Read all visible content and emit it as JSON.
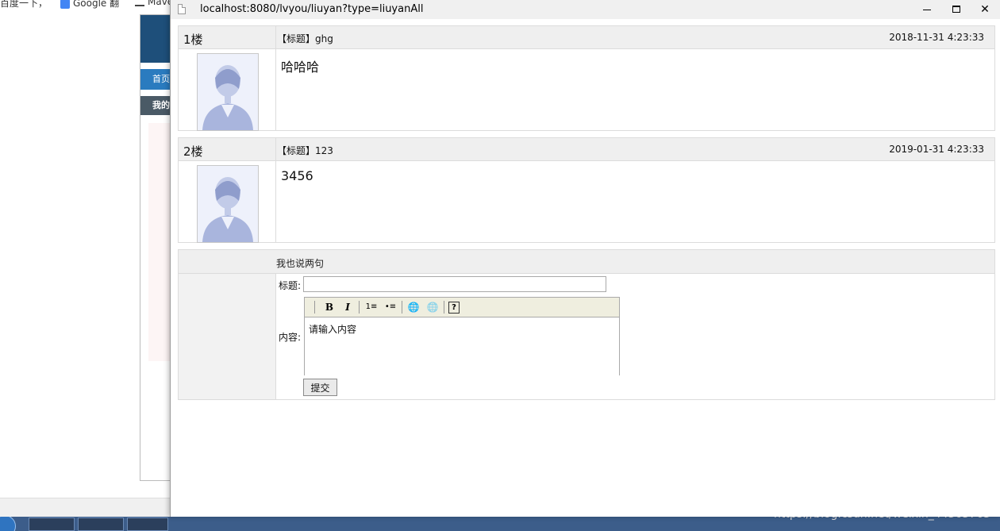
{
  "background": {
    "bookmarks": [
      "百度一下，",
      "Google 翻",
      "Mave"
    ],
    "nav_label": "首页",
    "sub_label": "我的"
  },
  "popup": {
    "url": "localhost:8080/lvyou/liuyan?type=liuyanAll",
    "controls": {
      "minimize": "—",
      "maximize": "☐",
      "close": "✕"
    }
  },
  "posts": [
    {
      "floor": "1楼",
      "title": "【标题】ghg",
      "date": "2018-11-31 4:23:33",
      "content": "哈哈哈"
    },
    {
      "floor": "2楼",
      "title": "【标题】123",
      "date": "2019-01-31 4:23:33",
      "content": "3456"
    }
  ],
  "reply": {
    "heading": "我也说两句",
    "title_label": "标题:",
    "title_value": "",
    "content_label": "内容:",
    "content_placeholder": "请输入内容",
    "submit_label": "提交",
    "toolbar": [
      {
        "label": "B",
        "icon": "bold-icon"
      },
      {
        "label": "I",
        "icon": "italic-icon"
      },
      {
        "label": "1≡",
        "icon": "ordered-list-icon"
      },
      {
        "label": "•≡",
        "icon": "unordered-list-icon"
      },
      {
        "label": "🌐",
        "icon": "link-icon"
      },
      {
        "label": "🌐",
        "icon": "unlink-icon"
      },
      {
        "label": "?",
        "icon": "help-icon"
      }
    ]
  },
  "watermark": "https://blog.csdn.net/weixin_44565765"
}
